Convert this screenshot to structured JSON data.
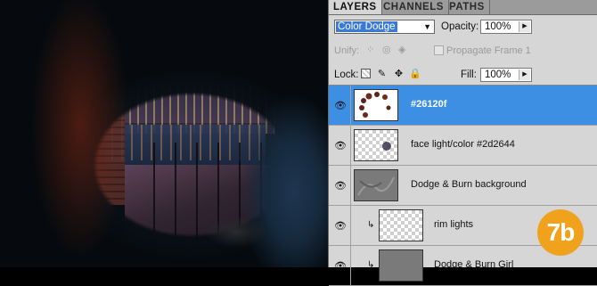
{
  "panel": {
    "tabs": [
      "LAYERS",
      "CHANNELS",
      "PATHS"
    ],
    "blend_mode": "Color Dodge",
    "opacity_label": "Opacity:",
    "opacity_value": "100%",
    "unify_label": "Unify:",
    "propagate_label": "Propagate Frame 1",
    "lock_label": "Lock:",
    "fill_label": "Fill:",
    "fill_value": "100%",
    "layers": [
      {
        "name": "#26120f",
        "selected": true,
        "thumb": "brown-strokes"
      },
      {
        "name": "face light/color #2d2644",
        "selected": false,
        "thumb": "transparent-dot"
      },
      {
        "name": "Dodge & Burn background",
        "selected": false,
        "thumb": "gray-texture"
      },
      {
        "name": "rim lights",
        "selected": false,
        "thumb": "transparent",
        "clipped": true
      },
      {
        "name": "Dodge & Burn Girl",
        "selected": false,
        "thumb": "gray-texture",
        "clipped": true
      }
    ]
  },
  "badge": {
    "text": "7b",
    "color": "#f0a21c"
  },
  "colors": {
    "selection": "#3d8fe3",
    "panel_bg": "#d6d6d6",
    "tab_bg": "#9b9b9b"
  }
}
